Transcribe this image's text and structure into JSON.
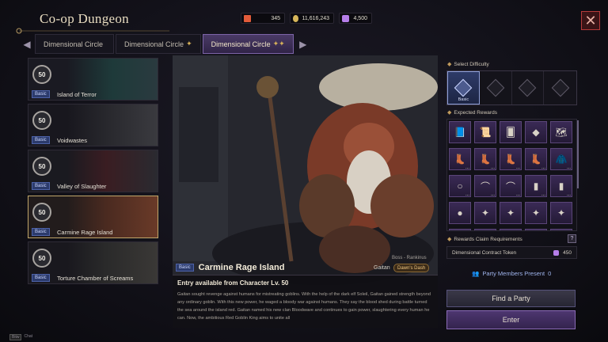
{
  "header": {
    "title": "Co-op Dungeon",
    "currencies": [
      {
        "icon": "stamina-icon",
        "value": "345",
        "color": "#e25b3a"
      },
      {
        "icon": "silver-icon",
        "value": "11,616,243",
        "color": "#d7b65a"
      },
      {
        "icon": "crystal-icon",
        "value": "4,500",
        "color": "#b57ee8"
      }
    ],
    "close_label": "✕"
  },
  "tabs": [
    {
      "label": "Dimensional Circle",
      "stars": ""
    },
    {
      "label": "Dimensional Circle",
      "stars": "✦"
    },
    {
      "label": "Dimensional Circle",
      "stars": "✦✦",
      "active": true
    }
  ],
  "dungeons": [
    {
      "level": "50",
      "tag": "Basic",
      "name": "Island of Terror",
      "color": "#1e3a3a"
    },
    {
      "level": "50",
      "tag": "Basic",
      "name": "Voidwastes",
      "color": "#2a2a2f"
    },
    {
      "level": "50",
      "tag": "Basic",
      "name": "Valley of Slaughter",
      "color": "#3a1d22"
    },
    {
      "level": "50",
      "tag": "Basic",
      "name": "Carmine Rage Island",
      "color": "#4a2a20",
      "active": true
    },
    {
      "level": "50",
      "tag": "Basic",
      "name": "Torture Chamber of Screams",
      "color": "#2a2a2a"
    }
  ],
  "selected": {
    "tag": "Basic",
    "name": "Carmine Rage Island",
    "boss_type": "Boss - Rankinus",
    "boss_name": "Gaitan",
    "boss_badge": "Dawn's Dash",
    "entry": "Entry available from Character Lv. 50",
    "description": "Gaitan sought revenge against humans for mistreating goblins. With the help of the dark elf Soleil, Gaitan gained strength beyond any ordinary goblin. With this new power, he waged a bloody war against humans. They say the blood shed during battle turned the sea around the island red. Gaitan named his new clan Bloodwave and continues to gain power, slaughtering every human he can. Now, the ambitious Red Goblin King aims to unite all"
  },
  "difficulty": {
    "label": "Select Difficulty",
    "options": [
      {
        "label": "Basic",
        "selected": true
      },
      {
        "label": ""
      },
      {
        "label": ""
      },
      {
        "label": ""
      }
    ]
  },
  "rewards": {
    "label": "Expected Rewards",
    "items": [
      {
        "icon": "book-icon",
        "glyph": "📘",
        "more": false
      },
      {
        "icon": "scroll-icon",
        "glyph": "📜",
        "more": false
      },
      {
        "icon": "card-icon",
        "glyph": "🂠",
        "more": false
      },
      {
        "icon": "gem-icon",
        "glyph": "◆",
        "more": false
      },
      {
        "icon": "map-icon",
        "glyph": "🗺",
        "more": false
      },
      {
        "icon": "boots-icon",
        "glyph": "👢",
        "more": true
      },
      {
        "icon": "boots-icon",
        "glyph": "👢",
        "more": true
      },
      {
        "icon": "boots-icon",
        "glyph": "👢",
        "more": true
      },
      {
        "icon": "boots-icon",
        "glyph": "👢",
        "more": true
      },
      {
        "icon": "cloak-icon",
        "glyph": "🧥",
        "more": true
      },
      {
        "icon": "ring-icon",
        "glyph": "○",
        "more": true
      },
      {
        "icon": "bow-icon",
        "glyph": "⌒",
        "more": true
      },
      {
        "icon": "bow-icon",
        "glyph": "⌒",
        "more": true
      },
      {
        "icon": "armor-icon",
        "glyph": "▮",
        "more": true
      },
      {
        "icon": "armor-icon",
        "glyph": "▮",
        "more": true
      },
      {
        "icon": "orb-icon",
        "glyph": "●",
        "more": false
      },
      {
        "icon": "star-icon",
        "glyph": "✦",
        "more": false
      },
      {
        "icon": "star-icon",
        "glyph": "✦",
        "more": false
      },
      {
        "icon": "star-icon",
        "glyph": "✦",
        "more": false
      },
      {
        "icon": "star-icon",
        "glyph": "✦",
        "more": false
      },
      {
        "icon": "shard-icon",
        "glyph": "◈",
        "more": false
      },
      {
        "icon": "shard-icon",
        "glyph": "◈",
        "more": false
      },
      {
        "icon": "shard-icon",
        "glyph": "◈",
        "more": false
      },
      {
        "icon": "shard-icon",
        "glyph": "◈",
        "more": false
      },
      {
        "icon": "shard-icon",
        "glyph": "◈",
        "more": false
      }
    ]
  },
  "claim": {
    "label": "Rewards Claim Requirements",
    "help": "?",
    "requirement": "Dimensional Contract Token",
    "value": "450"
  },
  "party": {
    "label": "Party Members Present",
    "count": "0"
  },
  "buttons": {
    "find_party": "Find a Party",
    "enter": "Enter"
  },
  "footer": {
    "key": "Bitw",
    "label": "Chat"
  }
}
